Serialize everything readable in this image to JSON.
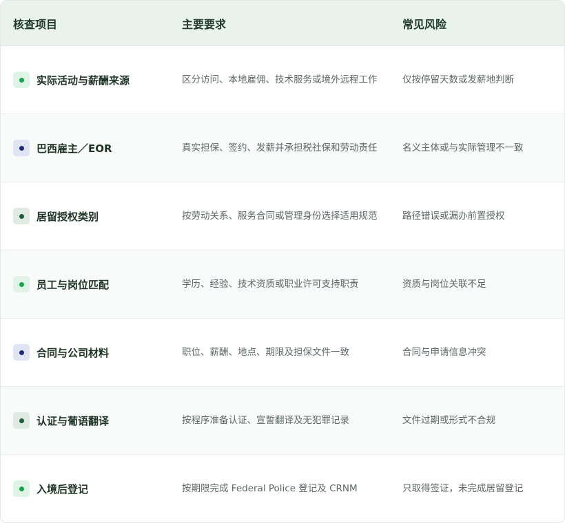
{
  "header": {
    "col1": "核查项目",
    "col2": "主要要求",
    "col3": "常见风险"
  },
  "rows": [
    {
      "title": "实际活动与薪酬来源",
      "requirement": "区分访问、本地雇佣、技术服务或境外远程工作",
      "risk": "仅按停留天数或发薪地判断",
      "badge_color": "#16a34a"
    },
    {
      "title": "巴西雇主／EOR",
      "requirement": "真实担保、签约、发薪并承担税社保和劳动责任",
      "risk": "名义主体或与实际管理不一致",
      "badge_color": "#1e2a78"
    },
    {
      "title": "居留授权类别",
      "requirement": "按劳动关系、服务合同或管理身份选择适用规范",
      "risk": "路径错误或漏办前置授权",
      "badge_color": "#1f5b3a"
    },
    {
      "title": "员工与岗位匹配",
      "requirement": "学历、经验、技术资质或职业许可支持职责",
      "risk": "资质与岗位关联不足",
      "badge_color": "#16a34a"
    },
    {
      "title": "合同与公司材料",
      "requirement": "职位、薪酬、地点、期限及担保文件一致",
      "risk": "合同与申请信息冲突",
      "badge_color": "#1e2a78"
    },
    {
      "title": "认证与葡语翻译",
      "requirement": "按程序准备认证、宣誓翻译及无犯罪记录",
      "risk": "文件过期或形式不合规",
      "badge_color": "#1f5b3a"
    },
    {
      "title": "入境后登记",
      "requirement": "按期限完成 Federal Police 登记及 CRNM",
      "risk": "只取得签证，未完成居留登记",
      "badge_color": "#16a34a"
    }
  ]
}
